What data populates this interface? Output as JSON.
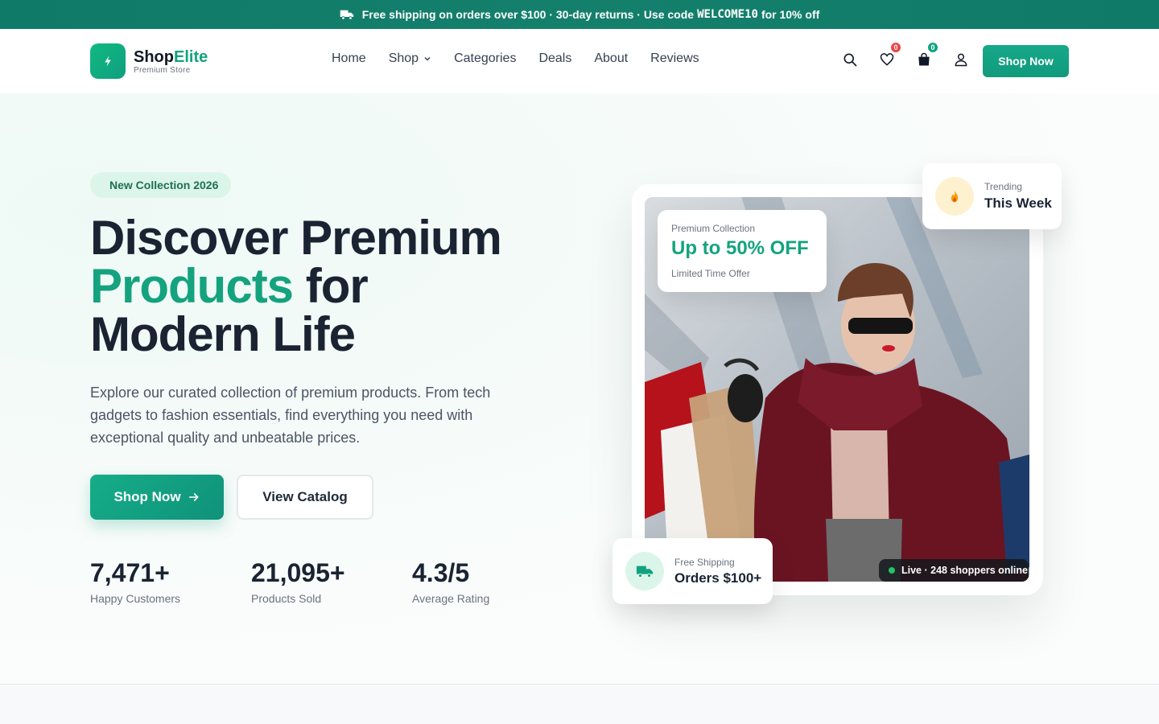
{
  "announcement": {
    "seg1": "Free shipping on orders over $100 · 30-day returns · Use code",
    "code": "WELCOME10",
    "seg2": "for 10% off",
    "icon": "truck-icon"
  },
  "brand": {
    "name_a": "Shop",
    "name_b": "Elite",
    "tagline": "Premium Store",
    "accent_color": "#10a37f"
  },
  "nav": {
    "items": [
      {
        "label": "Home"
      },
      {
        "label": "Shop"
      },
      {
        "label": "Categories"
      },
      {
        "label": "Deals"
      },
      {
        "label": "About"
      },
      {
        "label": "Reviews"
      }
    ]
  },
  "header_actions": {
    "wishlist_count": "0",
    "cart_count": "0",
    "cta_label": "Shop Now"
  },
  "hero": {
    "pill": "New Collection 2026",
    "title_line1": "Discover Premium",
    "title_line2_green": "Products",
    "title_line2_rest": " for",
    "title_line3": "Modern Life",
    "description": "Explore our curated collection of premium products. From tech gadgets to fashion essentials, find everything you need with exceptional quality and unbeatable prices.",
    "primary_button": "Shop Now",
    "secondary_button": "View Catalog",
    "stats": [
      {
        "value": "7,471+",
        "label": "Happy Customers"
      },
      {
        "value": "21,095+",
        "label": "Products Sold"
      },
      {
        "value": "4.3/5",
        "label": "Average Rating"
      }
    ]
  },
  "showcase": {
    "promo": {
      "small": "Premium Collection",
      "big": "Up to 50% OFF",
      "tiny": "Limited Time Offer"
    },
    "trending": {
      "small": "Trending",
      "big": "This Week"
    },
    "shipping": {
      "small": "Free Shipping",
      "big": "Orders $100+"
    },
    "live": "Live · 248 shoppers online"
  }
}
